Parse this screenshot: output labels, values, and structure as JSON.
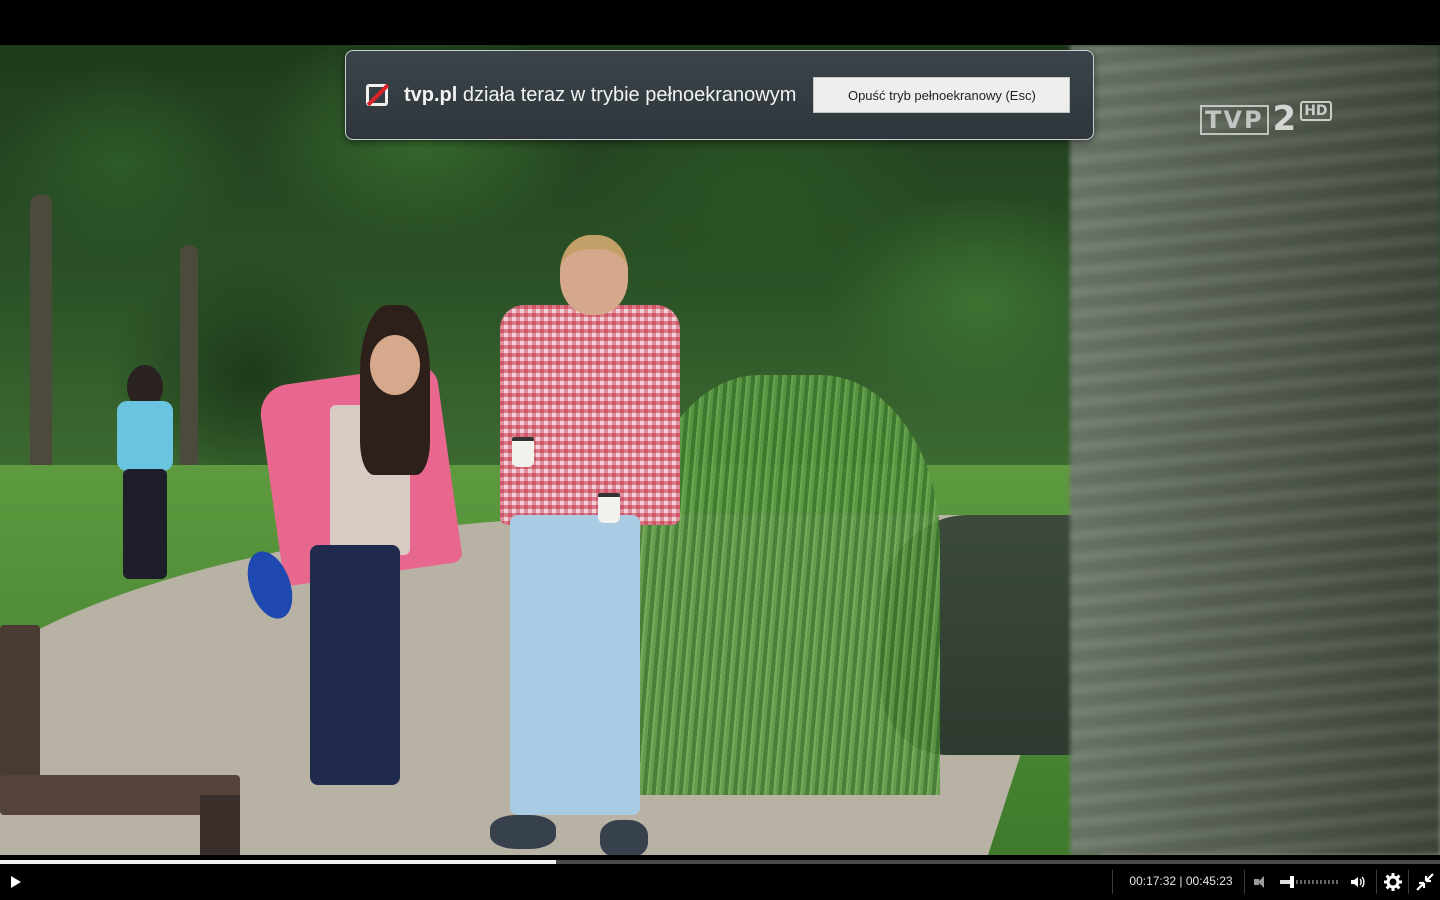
{
  "banner": {
    "domain": "tvp.pl",
    "message": " działa teraz w trybie pełnoekranowym",
    "exit_button": "Opuść tryb pełnoekranowy (Esc)"
  },
  "watermark": {
    "channel": "TVP",
    "number": "2",
    "quality": "HD"
  },
  "player": {
    "time_display": "00:17:32 | 00:45:23",
    "current_time": "00:17:32",
    "duration": "00:45:23",
    "progress_fraction": 0.386,
    "volume_fraction": 0.17,
    "icons": [
      "play-icon",
      "volume-low-icon",
      "volume-high-icon",
      "settings-gear-icon",
      "fullscreen-exit-icon"
    ]
  },
  "colors": {
    "banner_bg": "#2e363b",
    "progress_fill": "#f2f2f2",
    "fullscreen_icon_slash": "#d8232a"
  }
}
